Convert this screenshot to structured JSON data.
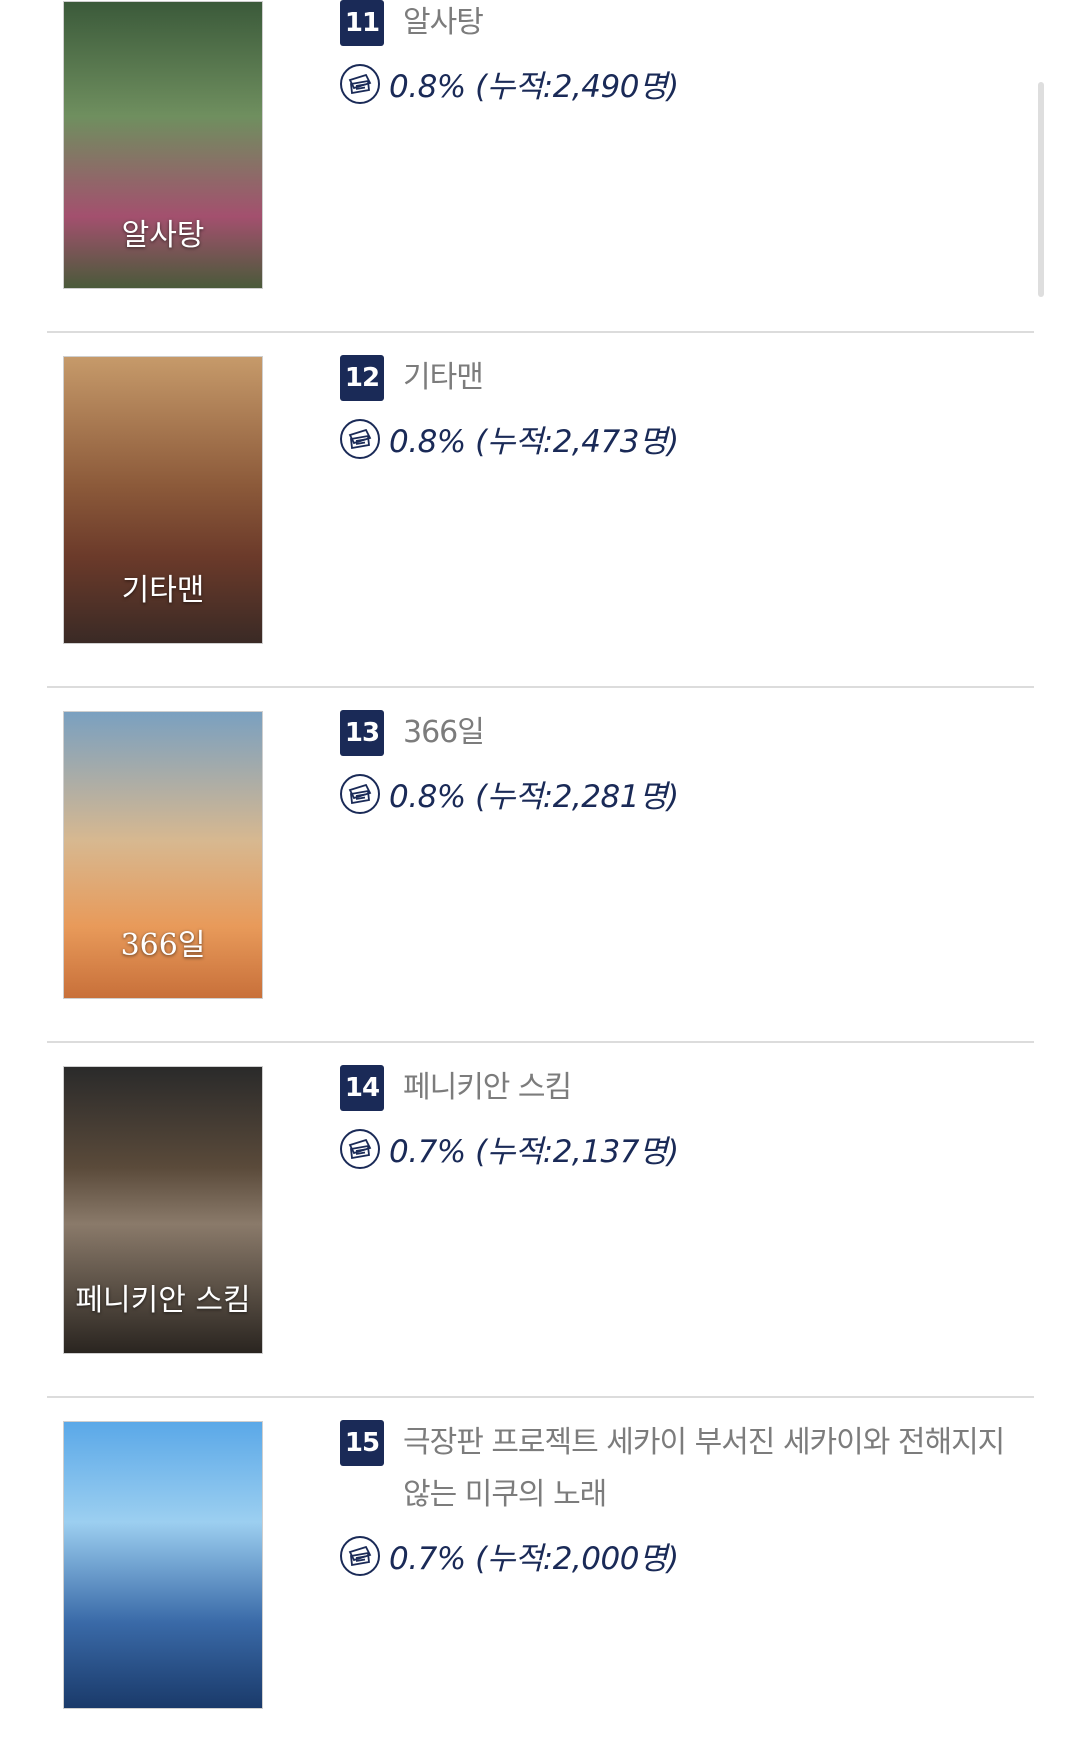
{
  "movies": [
    {
      "rank": "11",
      "title": "알사탕",
      "share": "0.8%",
      "audience": "(누적:2,490명)",
      "poster_title": "알사탕",
      "poster_bg": "linear-gradient(180deg,#3b5a3a 0%,#6f8f5f 40%,#a3506e 75%,#4a5a3a 100%)"
    },
    {
      "rank": "12",
      "title": "기타맨",
      "share": "0.8%",
      "audience": "(누적:2,473명)",
      "poster_title": "기타맨",
      "poster_bg": "linear-gradient(180deg,#c69a6a 0%,#8c5a3a 45%,#6b3a2a 70%,#3a2a25 100%)"
    },
    {
      "rank": "13",
      "title": "366일",
      "share": "0.8%",
      "audience": "(누적:2,281명)",
      "poster_title": "366일",
      "poster_bg": "linear-gradient(180deg,#7aa0c0 0%,#d7b890 45%,#e89a5a 75%,#c8703a 100%)"
    },
    {
      "rank": "14",
      "title": "페니키안 스킴",
      "share": "0.7%",
      "audience": "(누적:2,137명)",
      "poster_title": "페니키안 스킴",
      "poster_bg": "linear-gradient(180deg,#2a2a2a 0%,#5a4a3a 35%,#8a7a6a 55%,#2a2520 100%)"
    },
    {
      "rank": "15",
      "title": "극장판 프로젝트 세카이 부서진 세카이와 전해지지 않는 미쿠의 노래",
      "share": "0.7%",
      "audience": "(누적:2,000명)",
      "poster_title": "",
      "poster_bg": "linear-gradient(180deg,#5aa8e8 0%,#9ccff0 35%,#3a6aa8 70%,#1a3a6a 100%)"
    }
  ],
  "colors": {
    "accent": "#1a2a57",
    "title_gray": "#7c7c7c",
    "divider": "#dcdcdc"
  }
}
